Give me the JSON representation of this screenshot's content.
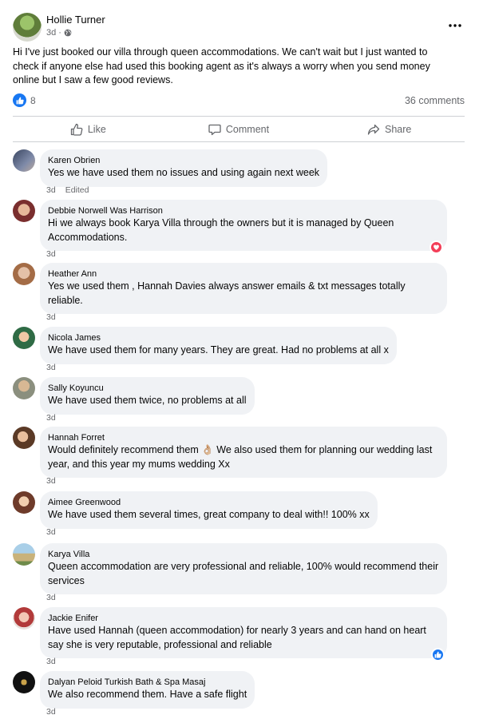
{
  "post": {
    "author": "Hollie Turner",
    "time": "3d",
    "text": "Hi I've just booked our villa through queen accommodations. We can't wait but I just wanted to check if anyone else had used this booking agent as it's always a worry when you send money online but I saw a few good reviews.",
    "reaction_count": "8",
    "comments_count": "36 comments",
    "icons": {
      "audience": "globe-icon",
      "more": "more-options-icon",
      "reaction": "like-icon"
    }
  },
  "actions": {
    "like": "Like",
    "comment": "Comment",
    "share": "Share"
  },
  "colors": {
    "accent": "#1877f2",
    "love": "#f33e58",
    "bubble": "#f0f2f5",
    "meta": "#65676b"
  },
  "comments": [
    {
      "name": "Karen Obrien",
      "text": "Yes we have used them no issues and using again next week",
      "time": "3d",
      "edited": "Edited"
    },
    {
      "name": "Debbie Norwell Was Harrison",
      "text": "Hi we always book Karya Villa through the owners but it is managed by Queen Accommodations.",
      "time": "3d",
      "reaction": "love-icon"
    },
    {
      "name": "Heather Ann",
      "text": "Yes we used them , Hannah Davies always answer emails & txt messages totally reliable.",
      "time": "3d"
    },
    {
      "name": "Nicola James",
      "text": "We have used them for many years. They are great. Had no problems at all x",
      "time": "3d"
    },
    {
      "name": "Sally Koyuncu",
      "text": "We have used them twice, no problems at all",
      "time": "3d"
    },
    {
      "name": "Hannah Forret",
      "text": "Would definitely recommend them 👌🏼 We also used them for planning our wedding last year, and this year my mums wedding Xx",
      "time": "3d"
    },
    {
      "name": "Aimee Greenwood",
      "text": "We have used them several times, great company to deal with!! 100% xx",
      "time": "3d"
    },
    {
      "name": "Karya Villa",
      "text": "Queen accommodation are very professional and reliable, 100% would recommend their services",
      "time": "3d"
    },
    {
      "name": "Jackie Enifer",
      "text": "Have used Hannah (queen accommodation) for nearly 3 years and can hand on heart say she is very reputable, professional and reliable",
      "time": "3d",
      "reaction": "like-icon"
    },
    {
      "name": "Dalyan Peloid Turkish Bath & Spa Masaj",
      "text": "We also recommend them. Have a safe flight",
      "time": "3d"
    }
  ]
}
